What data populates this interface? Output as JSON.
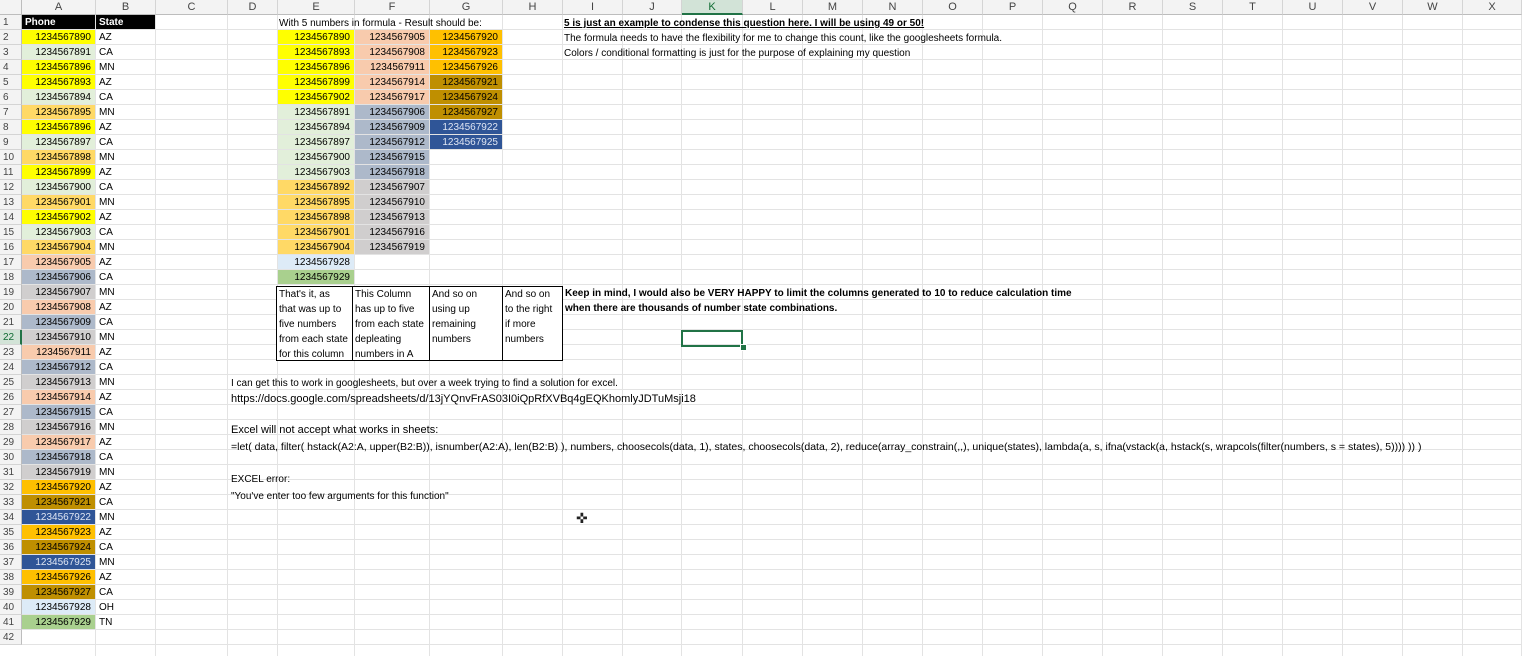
{
  "columns": [
    "A",
    "B",
    "C",
    "D",
    "E",
    "F",
    "G",
    "H",
    "I",
    "J",
    "K",
    "L",
    "M",
    "N",
    "O",
    "P",
    "Q",
    "R",
    "S",
    "T",
    "U",
    "V",
    "W",
    "X"
  ],
  "selected_column": "K",
  "selected_row": "22",
  "row_numbers": [
    "1",
    "2",
    "3",
    "4",
    "5",
    "6",
    "7",
    "8",
    "9",
    "10",
    "11",
    "12",
    "13",
    "14",
    "15",
    "16",
    "17",
    "18",
    "19",
    "20",
    "21",
    "22",
    "23",
    "24",
    "25",
    "26",
    "27",
    "28",
    "29",
    "30",
    "31",
    "32",
    "33",
    "34",
    "35",
    "36",
    "37",
    "38",
    "39",
    "40",
    "41",
    "42"
  ],
  "colors": {
    "yellow": "#ffff00",
    "peach": "#f8cbad",
    "light_orange": "#ffd966",
    "orange": "#ffc000",
    "dark_gold": "#bf8f00",
    "blue": "#2f5597",
    "green": "#e2efda",
    "grey": "#adb9ca",
    "light_grey": "#d0cece",
    "light_blue": "#ddebf7",
    "lime": "#a9d08e",
    "amber": "#f4b183"
  },
  "header_row": {
    "phone": "Phone",
    "state": "State"
  },
  "phones": [
    {
      "phone": "1234567890",
      "state": "AZ",
      "color": "yellow"
    },
    {
      "phone": "1234567891",
      "state": "CA",
      "color": "green"
    },
    {
      "phone": "1234567896",
      "state": "MN",
      "color": "yellow"
    },
    {
      "phone": "1234567893",
      "state": "AZ",
      "color": "yellow"
    },
    {
      "phone": "1234567894",
      "state": "CA",
      "color": "green"
    },
    {
      "phone": "1234567895",
      "state": "MN",
      "color": "light_orange"
    },
    {
      "phone": "1234567896",
      "state": "AZ",
      "color": "yellow"
    },
    {
      "phone": "1234567897",
      "state": "CA",
      "color": "green"
    },
    {
      "phone": "1234567898",
      "state": "MN",
      "color": "light_orange"
    },
    {
      "phone": "1234567899",
      "state": "AZ",
      "color": "yellow"
    },
    {
      "phone": "1234567900",
      "state": "CA",
      "color": "green"
    },
    {
      "phone": "1234567901",
      "state": "MN",
      "color": "light_orange"
    },
    {
      "phone": "1234567902",
      "state": "AZ",
      "color": "yellow"
    },
    {
      "phone": "1234567903",
      "state": "CA",
      "color": "green"
    },
    {
      "phone": "1234567904",
      "state": "MN",
      "color": "light_orange"
    },
    {
      "phone": "1234567905",
      "state": "AZ",
      "color": "peach"
    },
    {
      "phone": "1234567906",
      "state": "CA",
      "color": "grey"
    },
    {
      "phone": "1234567907",
      "state": "MN",
      "color": "light_grey"
    },
    {
      "phone": "1234567908",
      "state": "AZ",
      "color": "peach"
    },
    {
      "phone": "1234567909",
      "state": "CA",
      "color": "grey"
    },
    {
      "phone": "1234567910",
      "state": "MN",
      "color": "light_grey"
    },
    {
      "phone": "1234567911",
      "state": "AZ",
      "color": "peach"
    },
    {
      "phone": "1234567912",
      "state": "CA",
      "color": "grey"
    },
    {
      "phone": "1234567913",
      "state": "MN",
      "color": "light_grey"
    },
    {
      "phone": "1234567914",
      "state": "AZ",
      "color": "peach"
    },
    {
      "phone": "1234567915",
      "state": "CA",
      "color": "grey"
    },
    {
      "phone": "1234567916",
      "state": "MN",
      "color": "light_grey"
    },
    {
      "phone": "1234567917",
      "state": "AZ",
      "color": "peach"
    },
    {
      "phone": "1234567918",
      "state": "CA",
      "color": "grey"
    },
    {
      "phone": "1234567919",
      "state": "MN",
      "color": "light_grey"
    },
    {
      "phone": "1234567920",
      "state": "AZ",
      "color": "orange"
    },
    {
      "phone": "1234567921",
      "state": "CA",
      "color": "dark_gold"
    },
    {
      "phone": "1234567922",
      "state": "MN",
      "color": "blue"
    },
    {
      "phone": "1234567923",
      "state": "AZ",
      "color": "orange"
    },
    {
      "phone": "1234567924",
      "state": "CA",
      "color": "dark_gold"
    },
    {
      "phone": "1234567925",
      "state": "MN",
      "color": "blue"
    },
    {
      "phone": "1234567926",
      "state": "AZ",
      "color": "orange"
    },
    {
      "phone": "1234567927",
      "state": "CA",
      "color": "dark_gold"
    },
    {
      "phone": "1234567928",
      "state": "OH",
      "color": "light_blue"
    },
    {
      "phone": "1234567929",
      "state": "TN",
      "color": "lime"
    }
  ],
  "result_title": "With 5 numbers in formula - Result should be:",
  "result_columns": [
    [
      {
        "v": "1234567890",
        "color": "yellow"
      },
      {
        "v": "1234567893",
        "color": "yellow"
      },
      {
        "v": "1234567896",
        "color": "yellow"
      },
      {
        "v": "1234567899",
        "color": "yellow"
      },
      {
        "v": "1234567902",
        "color": "yellow"
      },
      {
        "v": "1234567891",
        "color": "green"
      },
      {
        "v": "1234567894",
        "color": "green"
      },
      {
        "v": "1234567897",
        "color": "green"
      },
      {
        "v": "1234567900",
        "color": "green"
      },
      {
        "v": "1234567903",
        "color": "green"
      },
      {
        "v": "1234567892",
        "color": "light_orange"
      },
      {
        "v": "1234567895",
        "color": "light_orange"
      },
      {
        "v": "1234567898",
        "color": "light_orange"
      },
      {
        "v": "1234567901",
        "color": "light_orange"
      },
      {
        "v": "1234567904",
        "color": "light_orange"
      },
      {
        "v": "1234567928",
        "color": "light_blue"
      },
      {
        "v": "1234567929",
        "color": "lime"
      }
    ],
    [
      {
        "v": "1234567905",
        "color": "peach"
      },
      {
        "v": "1234567908",
        "color": "peach"
      },
      {
        "v": "1234567911",
        "color": "peach"
      },
      {
        "v": "1234567914",
        "color": "peach"
      },
      {
        "v": "1234567917",
        "color": "peach"
      },
      {
        "v": "1234567906",
        "color": "grey"
      },
      {
        "v": "1234567909",
        "color": "grey"
      },
      {
        "v": "1234567912",
        "color": "grey"
      },
      {
        "v": "1234567915",
        "color": "grey"
      },
      {
        "v": "1234567918",
        "color": "grey"
      },
      {
        "v": "1234567907",
        "color": "light_grey"
      },
      {
        "v": "1234567910",
        "color": "light_grey"
      },
      {
        "v": "1234567913",
        "color": "light_grey"
      },
      {
        "v": "1234567916",
        "color": "light_grey"
      },
      {
        "v": "1234567919",
        "color": "light_grey"
      }
    ],
    [
      {
        "v": "1234567920",
        "color": "orange"
      },
      {
        "v": "1234567923",
        "color": "orange"
      },
      {
        "v": "1234567926",
        "color": "orange"
      },
      {
        "v": "1234567921",
        "color": "dark_gold"
      },
      {
        "v": "1234567924",
        "color": "dark_gold"
      },
      {
        "v": "1234567927",
        "color": "dark_gold"
      },
      {
        "v": "1234567922",
        "color": "blue"
      },
      {
        "v": "1234567925",
        "color": "blue"
      }
    ]
  ],
  "notes_boxes": [
    {
      "lines": [
        "That's it, as",
        "that was up to",
        "five numbers",
        "from each state",
        "for this column"
      ]
    },
    {
      "lines": [
        "This Column",
        "has up to five",
        "from each state",
        "depleating",
        "numbers in A"
      ]
    },
    {
      "lines": [
        "And so on",
        "using up",
        "remaining",
        "numbers"
      ]
    },
    {
      "lines": [
        "And so on",
        "to the right",
        "if more",
        "numbers"
      ]
    }
  ],
  "text": {
    "i1": "5 is just an example to condense this question here. I will be using 49 or 50!",
    "i2": "The formula needs to have the flexibility for me to change this count, like the googlesheets formula.",
    "i3": "Colors / conditional formatting is just for the purpose of explaining my question",
    "k1": "Keep in mind, I would also be VERY HAPPY to limit the columns generated to 10 to reduce calculation time",
    "k2": "when there are thousands of number state combinations.",
    "g1": "I can get this to work in googlesheets, but over a week trying to find a solution for excel.",
    "g2": "https://docs.google.com/spreadsheets/d/13jYQnvFrAS03I0iQpRfXVBq4gEQKhomlyJDTuMsji18",
    "e1": "Excel will not accept what works in sheets:",
    "formula": "=let( data, filter( hstack(A2:A, upper(B2:B)), isnumber(A2:A), len(B2:B) ), numbers, choosecols(data, 1), states, choosecols(data, 2), reduce(array_constrain(,,), unique(states), lambda(a, s, ifna(vstack(a, hstack(s, wrapcols(filter(numbers, s = states), 5)))) )) )",
    "err_title": "EXCEL error:",
    "err_msg": "\"You've enter too few arguments for this function\""
  }
}
